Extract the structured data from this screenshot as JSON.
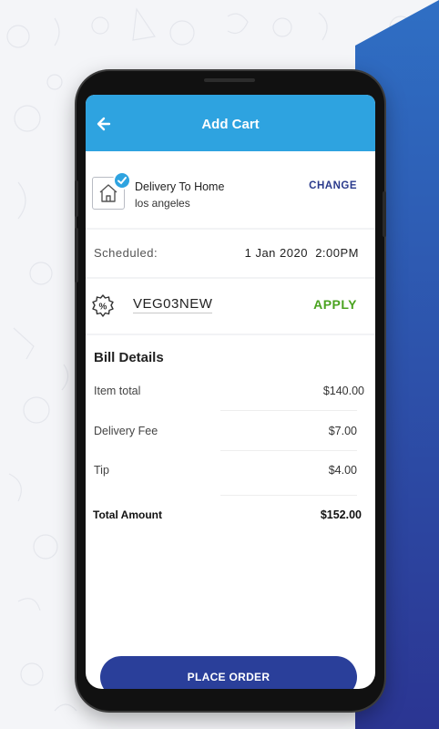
{
  "appbar": {
    "title": "Add Cart",
    "back_icon": "arrow-left-icon"
  },
  "delivery": {
    "type": "Delivery To Home",
    "location": "los angeles",
    "change_label": "CHANGE",
    "icon": "home-icon"
  },
  "schedule": {
    "label": "Scheduled:",
    "date": "1 Jan 2020",
    "time": "2:00PM"
  },
  "coupon": {
    "code": "VEG03NEW",
    "apply_label": "APPLY",
    "icon": "discount-badge-icon"
  },
  "bill": {
    "title": "Bill Details",
    "items": [
      {
        "label": "Item total",
        "value": "$140.00"
      },
      {
        "label": "Delivery Fee",
        "value": "$7.00"
      },
      {
        "label": "Tip",
        "value": "$4.00"
      }
    ],
    "total_label": "Total Amount",
    "total_value": "$152.00"
  },
  "place_order_label": "PLACE ORDER",
  "colors": {
    "primary": "#2ea3e0",
    "accent": "#2a3f9a",
    "apply": "#4aa320",
    "wedge": "#2b3d98"
  }
}
